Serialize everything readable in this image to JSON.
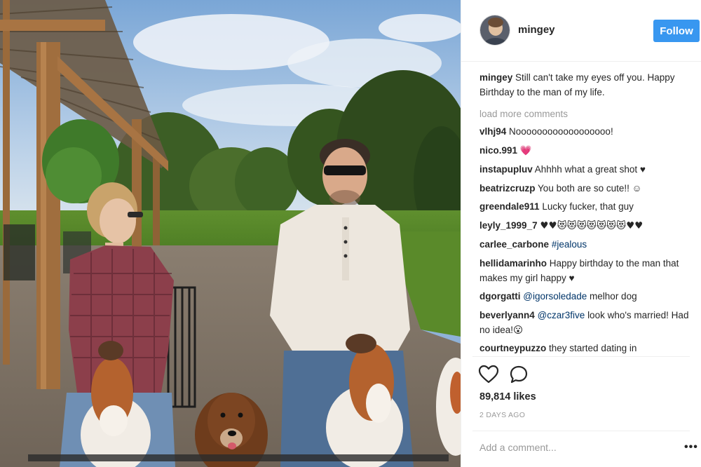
{
  "post": {
    "username": "mingey",
    "follow_label": "Follow",
    "caption": {
      "user": "mingey",
      "text": "Still can't take my eyes off you. Happy Birthday to the man of my life."
    },
    "load_more": "load more comments",
    "comments": [
      {
        "user": "vlhj94",
        "text": "Noooooooooooooooooo!"
      },
      {
        "user": "nico.991",
        "text": "💗"
      },
      {
        "user": "instapupluv",
        "text": "Ahhhh what a great shot ♥"
      },
      {
        "user": "beatrizcruzp",
        "text": "You both are so cute!! ☺"
      },
      {
        "user": "greendale911",
        "text": "Lucky fucker, that guy"
      },
      {
        "user": "leyly_1999_7",
        "text": "♥♥😻😻😻😻😻😻😻♥♥"
      },
      {
        "user": "carlee_carbone",
        "mention": "#jealous",
        "text": ""
      },
      {
        "user": "hellidamarinho",
        "text": "Happy birthday to the man that makes my girl happy ♥"
      },
      {
        "user": "dgorgatti",
        "mention": "@igorsoledade",
        "text": "melhor dog"
      },
      {
        "user": "beverlyann4",
        "mention": "@czar3five",
        "text": "look who's married! Had no idea!😮"
      },
      {
        "user": "courtneypuzzo",
        "text": "they started dating in"
      }
    ],
    "likes": "89,814 likes",
    "time": "2 DAYS AGO",
    "add_comment_placeholder": "Add a comment...",
    "more_label": "•••"
  },
  "icons": {
    "like": "heart-outline-icon",
    "comment": "speech-bubble-icon",
    "more": "ellipsis-icon"
  },
  "colors": {
    "follow": "#3897f0",
    "mention": "#003569",
    "muted": "#999999"
  }
}
